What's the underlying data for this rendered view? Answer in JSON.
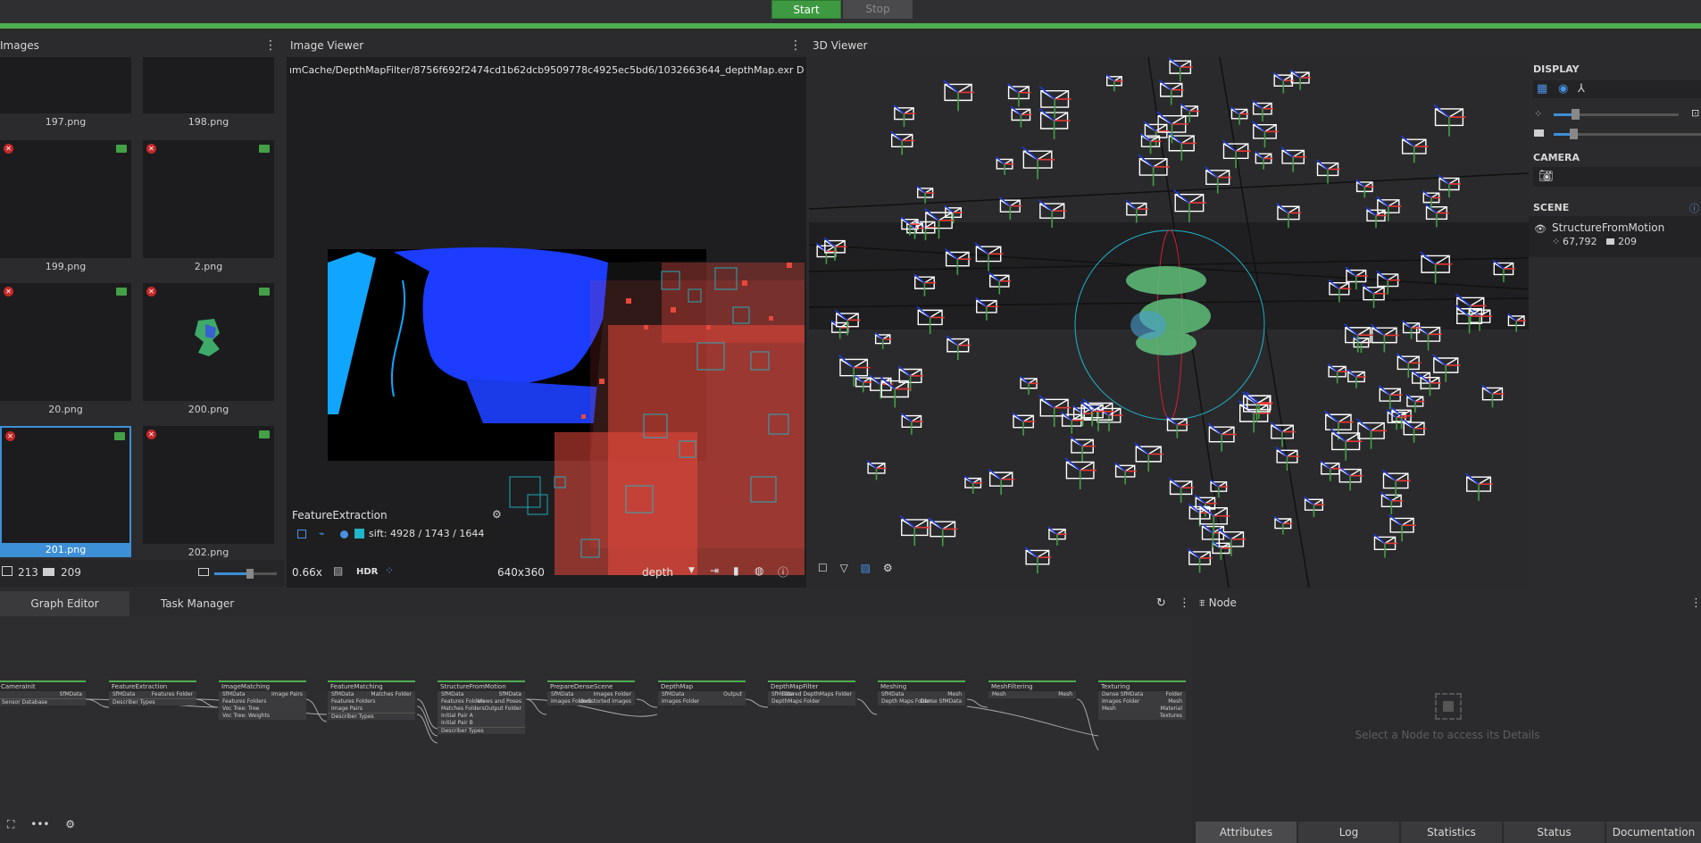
{
  "toolbar": {
    "start_label": "Start",
    "stop_label": "Stop"
  },
  "images_panel": {
    "title": "Images",
    "thumbnails": [
      {
        "label": "197.png"
      },
      {
        "label": "198.png"
      },
      {
        "label": "199.png"
      },
      {
        "label": "2.png"
      },
      {
        "label": "20.png"
      },
      {
        "label": "200.png"
      },
      {
        "label": "201.png",
        "selected": true
      },
      {
        "label": "202.png"
      }
    ],
    "footer": {
      "image_count": "213",
      "camera_count": "209"
    }
  },
  "image_viewer": {
    "title": "Image Viewer",
    "path": "ımCache/DepthMapFilter/8756f692f2474cd1b62dcb9509778c4925ec5bd6/1032663644_depthMap.exr",
    "node_label": "DepthMapFilter",
    "feature_panel_title": "FeatureExtraction",
    "feature_stats": "sift: 4928 / 1743 / 1644",
    "zoom": "0.66x",
    "hdr_label": "HDR",
    "resolution": "640x360",
    "channel": "depth"
  },
  "viewer3d": {
    "title": "3D Viewer"
  },
  "display_panel": {
    "display_title": "DISPLAY",
    "camera_title": "CAMERA",
    "scene_title": "SCENE",
    "scene_item": "StructureFromMotion",
    "points": "67,792",
    "cameras": "209"
  },
  "graph_editor": {
    "tabs": [
      {
        "label": "Graph Editor"
      },
      {
        "label": "Task Manager"
      }
    ],
    "nodes": [
      {
        "title": "CameraInit",
        "left": [],
        "right": [
          "SfMData"
        ],
        "extra": [
          "Sensor Database"
        ]
      },
      {
        "title": "FeatureExtraction",
        "left": [
          "SfMData"
        ],
        "right": [
          "Features Folder"
        ],
        "extra": [
          "Describer Types"
        ]
      },
      {
        "title": "ImageMatching",
        "left": [
          "SfMData",
          "Features Folders",
          "Voc Tree: Tree",
          "Voc Tree: Weights"
        ],
        "right": [
          "Image Pairs"
        ],
        "extra": []
      },
      {
        "title": "FeatureMatching",
        "left": [
          "SfMData",
          "Features Folders",
          "Image Pairs"
        ],
        "right": [
          "Matches Folder"
        ],
        "extra": [
          "Describer Types"
        ]
      },
      {
        "title": "StructureFromMotion",
        "left": [
          "SfMData",
          "Features Folders",
          "Matches Folders",
          "Initial Pair A",
          "Initial Pair B"
        ],
        "right": [
          "SfMData",
          "Views and Poses",
          "Output Folder"
        ],
        "extra": [
          "Describer Types"
        ]
      },
      {
        "title": "PrepareDenseScene",
        "left": [
          "SfMData",
          "Images Folders"
        ],
        "right": [
          "Images Folder",
          "Undistorted images"
        ],
        "extra": []
      },
      {
        "title": "DepthMap",
        "left": [
          "SfMData",
          "Images Folder"
        ],
        "right": [
          "Output"
        ],
        "extra": []
      },
      {
        "title": "DepthMapFilter",
        "left": [
          "SfMData",
          "DepthMaps Folder"
        ],
        "right": [
          "Filtered DepthMaps Folder"
        ],
        "extra": []
      },
      {
        "title": "Meshing",
        "left": [
          "SfMData",
          "Depth Maps Folder"
        ],
        "right": [
          "Mesh",
          "Dense SfMData"
        ],
        "extra": []
      },
      {
        "title": "MeshFiltering",
        "left": [
          "Mesh"
        ],
        "right": [
          "Mesh"
        ],
        "extra": []
      },
      {
        "title": "Texturing",
        "left": [
          "Dense SfMData",
          "Images Folder",
          "Mesh"
        ],
        "right": [
          "Folder",
          "Mesh",
          "Material",
          "Textures"
        ],
        "extra": []
      }
    ]
  },
  "node_panel": {
    "title": "Node",
    "placeholder": "Select a Node to access its Details",
    "tabs": [
      {
        "label": "Attributes"
      },
      {
        "label": "Log"
      },
      {
        "label": "Statistics"
      },
      {
        "label": "Status"
      },
      {
        "label": "Documentation"
      }
    ]
  },
  "colors": {
    "accent_green": "#4caf50",
    "selection_blue": "#3d8fd6",
    "feature_red": "#e8483c",
    "feature_cyan": "#1fb6c9",
    "depth_blue": "#1a3cff"
  }
}
